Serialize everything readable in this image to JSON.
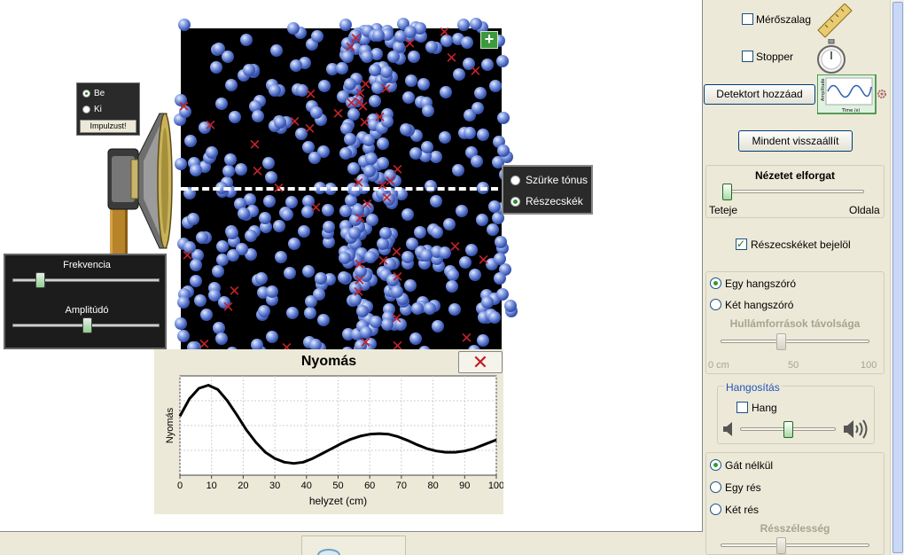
{
  "sim": {
    "plus_label": "+",
    "pulse_panel": {
      "on_label": "Be",
      "off_label": "Ki",
      "selected": "on",
      "impulse_label": "Impulzust!"
    },
    "freq_panel": {
      "frequency_label": "Frekvencia",
      "amplitude_label": "Amplitúdó",
      "frequency_level": 0.17,
      "amplitude_level": 0.51
    },
    "view_panel": {
      "gray_label": "Szürke tónus",
      "particles_label": "Részecskék",
      "selected": "particles"
    }
  },
  "graph": {
    "title": "Nyomás",
    "close_label": "✕",
    "chart_data": {
      "type": "line",
      "title": "Nyomás",
      "xlabel": "helyzet (cm)",
      "ylabel": "Nyomás",
      "xlim": [
        0,
        100
      ],
      "x_ticks": [
        0,
        10,
        20,
        30,
        40,
        50,
        60,
        70,
        80,
        90,
        100
      ],
      "grid": true,
      "series": [
        {
          "x": [
            0,
            3,
            6,
            9,
            12,
            15,
            18,
            21,
            24,
            27,
            30,
            33,
            36,
            39,
            42,
            45,
            48,
            51,
            54,
            57,
            60,
            63,
            66,
            69,
            72,
            75,
            78,
            81,
            84,
            87,
            90,
            93,
            96,
            100
          ],
          "y": [
            0.5,
            0.78,
            0.95,
            1.0,
            0.93,
            0.75,
            0.52,
            0.28,
            0.08,
            -0.08,
            -0.18,
            -0.24,
            -0.26,
            -0.24,
            -0.18,
            -0.1,
            -0.02,
            0.06,
            0.13,
            0.18,
            0.21,
            0.22,
            0.21,
            0.17,
            0.11,
            0.04,
            -0.02,
            -0.06,
            -0.08,
            -0.08,
            -0.06,
            -0.02,
            0.04,
            0.12
          ]
        }
      ]
    }
  },
  "controls": {
    "tape_label": "Mérőszalag",
    "tape_checked": false,
    "stopwatch_label": "Stopper",
    "stopwatch_checked": false,
    "add_detector_label": "Detektort hozzáad",
    "reset_label": "Mindent visszaállít",
    "rotate_title": "Nézetet elforgat",
    "rotate_min": "Teteje",
    "rotate_max": "Oldala",
    "rotate_level": 0.0,
    "mark_particles_label": "Részecskéket bejelöl",
    "mark_particles_checked": true,
    "one_speaker_label": "Egy hangszóró",
    "two_speakers_label": "Két hangszóró",
    "speaker_selected": "one",
    "source_distance_label": "Hullámforrások távolsága",
    "distance_ticks": [
      "0 cm",
      "50",
      "100"
    ],
    "distance_level": 0.4,
    "sound_title": "Hangosítás",
    "sound_label": "Hang",
    "sound_checked": false,
    "volume_level": 0.5,
    "barrier_none_label": "Gát nélkül",
    "barrier_one_label": "Egy rés",
    "barrier_two_label": "Két rés",
    "barrier_selected": "none",
    "slit_width_label": "Résszélesség",
    "slit_width_level": 0.4,
    "thumb_axis": "Amplitude",
    "thumb_time": "Time (s)"
  },
  "colors": {
    "accent": "#2f9a2f",
    "chamber": "#000000",
    "marker": "#c0232b",
    "particle": "#3f5cb8"
  }
}
